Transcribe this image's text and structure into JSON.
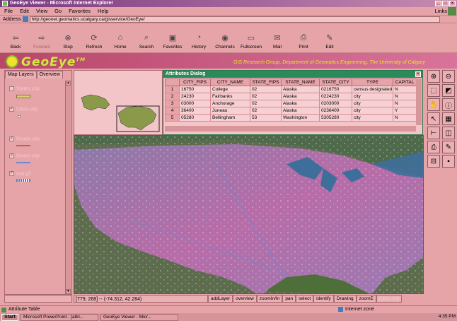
{
  "browser": {
    "title": "GeoEye Viewer - Microsoft Internet Explorer",
    "menu": [
      "File",
      "Edit",
      "View",
      "Go",
      "Favorites",
      "Help"
    ],
    "links_label": "Links",
    "address_label": "Address",
    "address_url": "http://geonet.geomatics.ucalgary.ca/gisservice/GeoEye/",
    "toolbar": [
      {
        "label": "Back",
        "icon": "back-arrow-icon",
        "disabled": false
      },
      {
        "label": "Forward",
        "icon": "forward-arrow-icon",
        "disabled": true
      },
      {
        "label": "Stop",
        "icon": "stop-icon",
        "disabled": false
      },
      {
        "label": "Refresh",
        "icon": "refresh-icon",
        "disabled": false
      },
      {
        "label": "Home",
        "icon": "home-icon",
        "disabled": false
      },
      {
        "label": "Search",
        "icon": "search-icon",
        "disabled": false
      },
      {
        "label": "Favorites",
        "icon": "favorites-icon",
        "disabled": false
      },
      {
        "label": "History",
        "icon": "history-icon",
        "disabled": false
      },
      {
        "label": "Channels",
        "icon": "channels-icon",
        "disabled": false
      },
      {
        "label": "Fullscreen",
        "icon": "fullscreen-icon",
        "disabled": false
      },
      {
        "label": "Mail",
        "icon": "mail-icon",
        "disabled": false
      },
      {
        "label": "Print",
        "icon": "print-icon",
        "disabled": false
      },
      {
        "label": "Edit",
        "icon": "edit-icon",
        "disabled": false
      }
    ],
    "status_text": "Attribute Table",
    "zone": "Internet zone"
  },
  "app": {
    "name": "GeoEye",
    "tm": "TM",
    "subtitle": "GIS Research Group, Department of Geomatics Engineering, The University of Calgary",
    "tabs": [
      "Map Layers",
      "Overview"
    ],
    "layers": [
      {
        "name": "States.shp",
        "checked": false,
        "swatch": "#d9d070"
      },
      {
        "name": "Cities.shp",
        "checked": true,
        "swatch": "#ffffff"
      },
      {
        "name": "Roads.shp",
        "checked": true,
        "swatch": "#c0605a"
      },
      {
        "name": "Rivers.shp",
        "checked": true,
        "swatch": "#6a8ad0"
      },
      {
        "name": "usa.gif",
        "checked": true,
        "swatch": "#5a7ac0"
      }
    ]
  },
  "attributes": {
    "title": "Attributes Dialog",
    "columns": [
      "",
      "CITY_FIPS",
      "CITY_NAME",
      "STATE_FIPS",
      "STATE_NAME",
      "STATE_CITY",
      "TYPE",
      "CAPITAL"
    ],
    "rows": [
      [
        "1",
        "16750",
        "College",
        "02",
        "Alaska",
        "0216750",
        "census designated",
        "N"
      ],
      [
        "2",
        "24230",
        "Fairbanks",
        "02",
        "Alaska",
        "0224230",
        "city",
        "N"
      ],
      [
        "3",
        "03000",
        "Anchorage",
        "02",
        "Alaska",
        "0203000",
        "city",
        "N"
      ],
      [
        "4",
        "36400",
        "Juneau",
        "02",
        "Alaska",
        "0236400",
        "city",
        "Y"
      ],
      [
        "5",
        "05280",
        "Bellingham",
        "53",
        "Washington",
        "5305280",
        "city",
        "N"
      ]
    ]
  },
  "status": {
    "coords": "[779, 268] -- (-74.312, 42.284)",
    "buttons": [
      "addLayer",
      "overview",
      "zoomIn/In",
      "pan",
      "select",
      "identify",
      "Drawing",
      "zoomE",
      "Cities.shp"
    ]
  },
  "taskbar": {
    "start": "Start",
    "tasks": [
      "Microsoft PowerPoint - [attri...",
      "GeoEye Viewer - Micr..."
    ],
    "clock": "4:35 PM"
  },
  "colors": {
    "accent": "#2a8a5a",
    "header": "#b8476a",
    "logo_text": "#d2e83a"
  }
}
